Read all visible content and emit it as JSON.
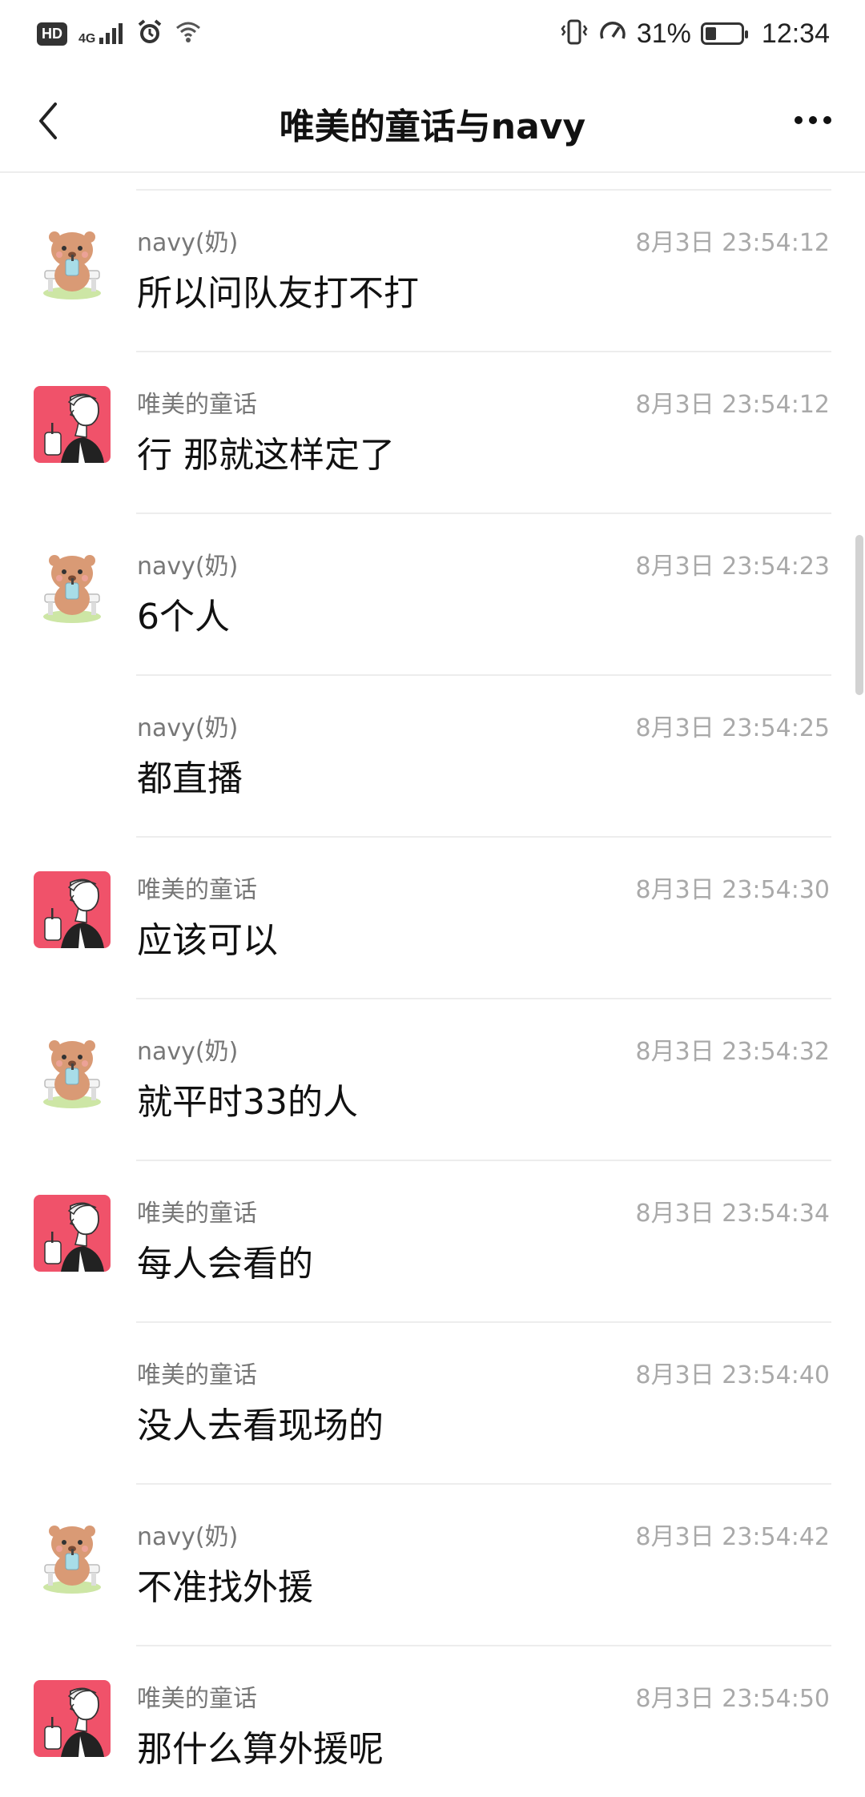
{
  "status_bar": {
    "hd": "HD",
    "net": "4G",
    "battery_percent": "31%",
    "battery_level": 0.31,
    "time": "12:34"
  },
  "header": {
    "title": "唯美的童话与navy"
  },
  "messages": [
    {
      "sender": "navy(奶)",
      "time": "8月3日 23:54:12",
      "text": "所以问队友打不打",
      "avatar": "bear"
    },
    {
      "sender": "唯美的童话",
      "time": "8月3日 23:54:12",
      "text": "行 那就这样定了",
      "avatar": "girl"
    },
    {
      "sender": "navy(奶)",
      "time": "8月3日 23:54:23",
      "text": "6个人",
      "avatar": "bear"
    },
    {
      "sender": "navy(奶)",
      "time": "8月3日 23:54:25",
      "text": "都直播",
      "avatar": "none"
    },
    {
      "sender": "唯美的童话",
      "time": "8月3日 23:54:30",
      "text": "应该可以",
      "avatar": "girl"
    },
    {
      "sender": "navy(奶)",
      "time": "8月3日 23:54:32",
      "text": "就平时33的人",
      "avatar": "bear"
    },
    {
      "sender": "唯美的童话",
      "time": "8月3日 23:54:34",
      "text": "每人会看的",
      "avatar": "girl"
    },
    {
      "sender": "唯美的童话",
      "time": "8月3日 23:54:40",
      "text": "没人去看现场的",
      "avatar": "none"
    },
    {
      "sender": "navy(奶)",
      "time": "8月3日 23:54:42",
      "text": "不准找外援",
      "avatar": "bear"
    },
    {
      "sender": "唯美的童话",
      "time": "8月3日 23:54:50",
      "text": "那什么算外援呢",
      "avatar": "girl"
    }
  ],
  "colors": {
    "girl_avatar_bg": "#f0526a",
    "bear_body": "#d99a75",
    "divider": "#ededed"
  }
}
